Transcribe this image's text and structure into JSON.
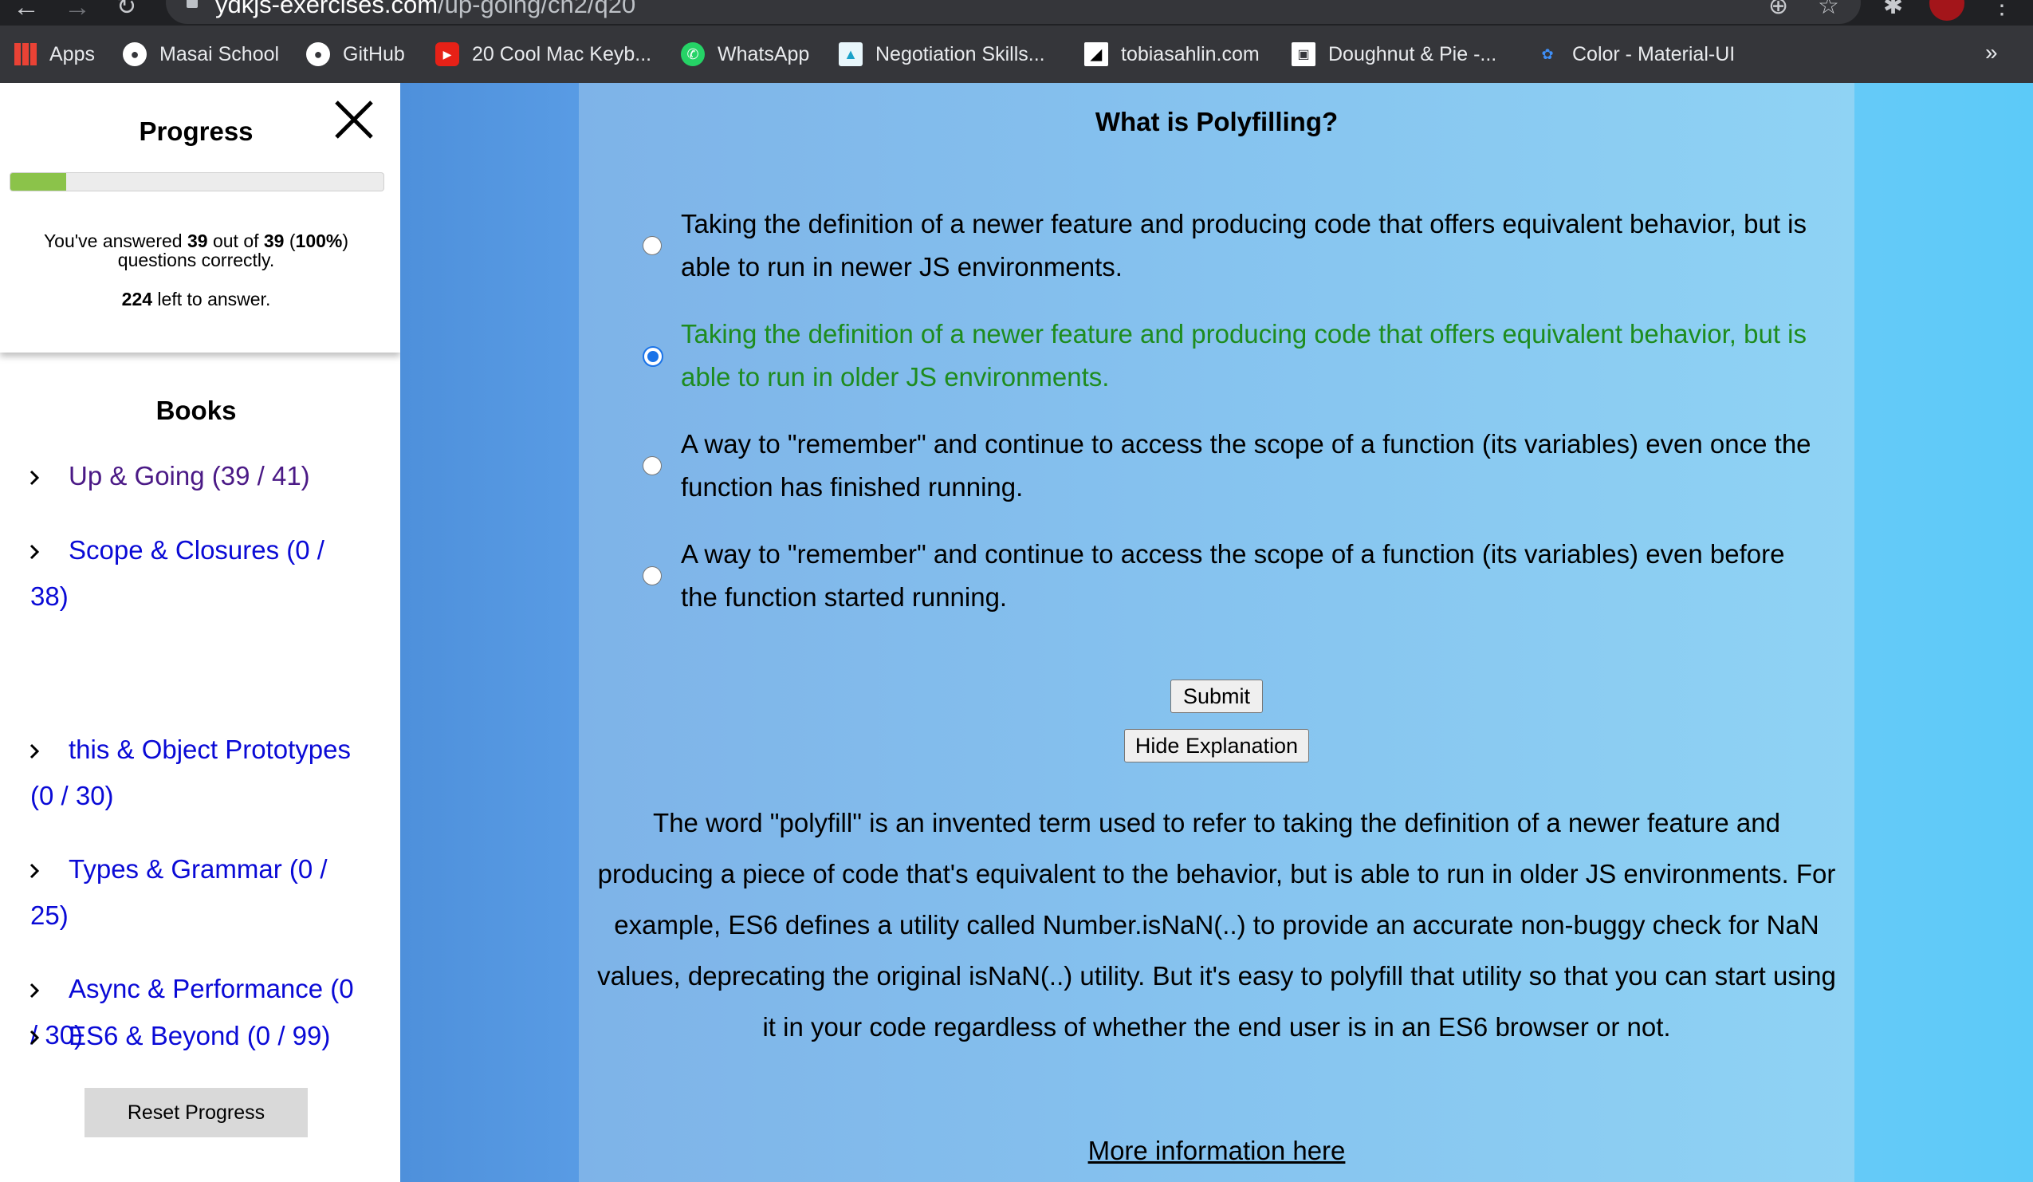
{
  "browser": {
    "url_host": "ydkjs-exercises.com",
    "url_path": "/up-going/ch2/q20",
    "bookmarks": [
      {
        "label": "Apps"
      },
      {
        "label": "Masai School"
      },
      {
        "label": "GitHub"
      },
      {
        "label": "20 Cool Mac Keyb..."
      },
      {
        "label": "WhatsApp"
      },
      {
        "label": "Negotiation Skills..."
      },
      {
        "label": "tobiasahlin.com"
      },
      {
        "label": "Doughnut & Pie -..."
      },
      {
        "label": "Color - Material-UI"
      }
    ],
    "more_label": "»"
  },
  "sidebar": {
    "progress_title": "Progress",
    "progress_fraction": 0.15,
    "answered_prefix": "You've answered ",
    "answered_count": "39",
    "answered_mid": " out of ",
    "total_count": "39",
    "answered_paren_open": " (",
    "answered_percent": "100%",
    "answered_suffix": ") questions correctly.",
    "left_count": "224",
    "left_suffix": " left to answer.",
    "books_title": "Books",
    "books": [
      {
        "label": "Up & Going (39 / 41)"
      },
      {
        "label": "Scope & Closures (0 / 38)"
      },
      {
        "label": "this & Object Prototypes (0 / 30)"
      },
      {
        "label": "Types & Grammar (0 / 25)"
      },
      {
        "label": "Async & Performance (0 / 30)"
      },
      {
        "label": "ES6 & Beyond (0 / 99)"
      }
    ],
    "reset_label": "Reset Progress"
  },
  "quiz": {
    "question": "What is Polyfilling?",
    "options": [
      {
        "text": "Taking the definition of a newer feature and producing code that offers equivalent behavior, but is able to run in newer JS environments.",
        "selected": false
      },
      {
        "text": "Taking the definition of a newer feature and producing code that offers equivalent behavior, but is able to run in older JS environments.",
        "selected": true
      },
      {
        "text": "A way to \"remember\" and continue to access the scope of a function (its variables) even once the function has finished running.",
        "selected": false
      },
      {
        "text": "A way to \"remember\" and continue to access the scope of a function (its variables) even before the function started running.",
        "selected": false
      }
    ],
    "submit_label": "Submit",
    "hide_explanation_label": "Hide Explanation",
    "explanation": "The word \"polyfill\" is an invented term used to refer to taking the definition of a newer feature and producing a piece of code that's equivalent to the behavior, but is able to run in older JS environments. For example, ES6 defines a utility called Number.isNaN(..) to provide an accurate non-buggy check for NaN values, deprecating the original isNaN(..) utility. But it's easy to polyfill that utility so that you can start using it in your code regardless of whether the end user is in an ES6 browser or not.",
    "more_info_label": "More information here"
  },
  "colors": {
    "correct_text": "#1e8c1e",
    "progress_fill": "#8bc34a",
    "link_blue": "#0a0ad6",
    "link_visited": "#4b1a86",
    "radio_checked": "#1a73e8"
  }
}
